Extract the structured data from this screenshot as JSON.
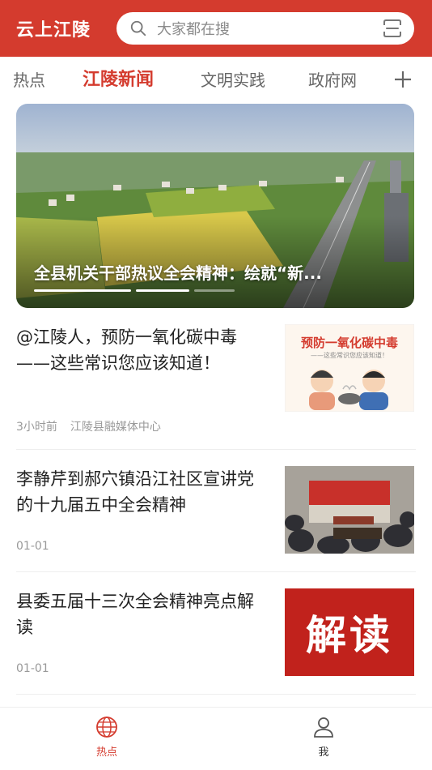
{
  "header": {
    "app_title": "云上江陵",
    "search_placeholder": "大家都在搜",
    "brand_color": "#d43b2e"
  },
  "tabs": [
    {
      "label": "热点",
      "active": false
    },
    {
      "label": "江陵新闻",
      "active": true
    },
    {
      "label": "文明实践",
      "active": false
    },
    {
      "label": "政府网",
      "active": false
    }
  ],
  "banner": {
    "title": "全县机关干部热议全会精神：绘就“新...",
    "slide_count": 3,
    "active_slide": 1
  },
  "news": [
    {
      "title": "@江陵人，预防一氧化碳中毒——这些常识您应该知道！",
      "time": "3小时前",
      "source": "江陵县融媒体中心",
      "thumb": {
        "title": "预防一氧化碳中毒",
        "subtitle": "——这些常识您应该知道！"
      }
    },
    {
      "title": "李静芹到郝穴镇沿江社区宣讲党的十九届五中全会精神",
      "time": "01-01",
      "source": ""
    },
    {
      "title": "县委五届十三次全会精神亮点解读",
      "time": "01-01",
      "source": "",
      "thumb": {
        "text": "解读"
      }
    }
  ],
  "bottom_nav": [
    {
      "label": "热点",
      "icon": "globe-icon",
      "active": true
    },
    {
      "label": "我",
      "icon": "user-icon",
      "active": false
    }
  ]
}
